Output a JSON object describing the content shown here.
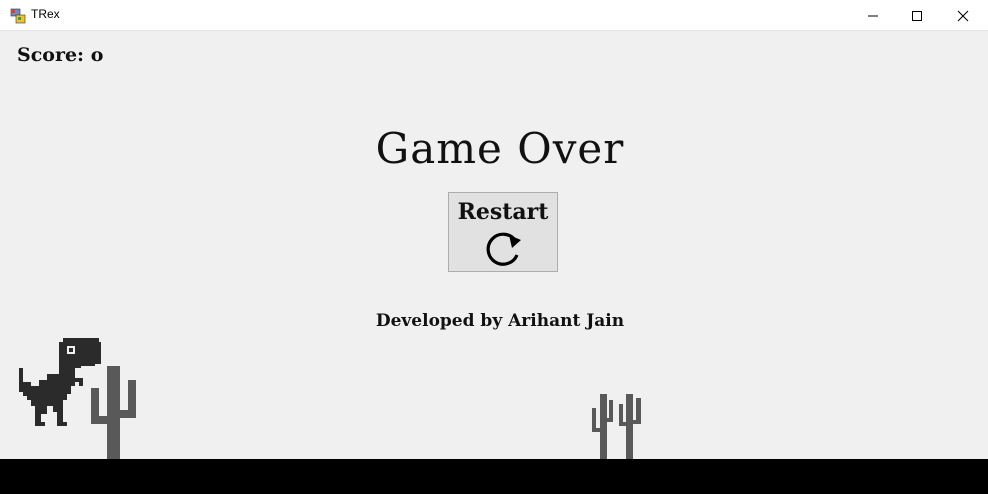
{
  "window": {
    "title": "TRex",
    "controls": [
      "minimize-icon",
      "maximize-icon",
      "close-icon"
    ]
  },
  "game": {
    "score_label": "Score: o",
    "status": "Game Over",
    "restart_label": "Restart",
    "restart_icon": "refresh-icon",
    "credit": "Developed by Arihant Jain",
    "sprites": [
      "dino-sprite",
      "cactus-sprite",
      "cactus-sprite"
    ]
  },
  "colors": {
    "background": "#f0f0f0",
    "ground": "#000000",
    "dino": "#2b2b2b",
    "cactus": "#595959",
    "button": "#e1e1e1"
  }
}
